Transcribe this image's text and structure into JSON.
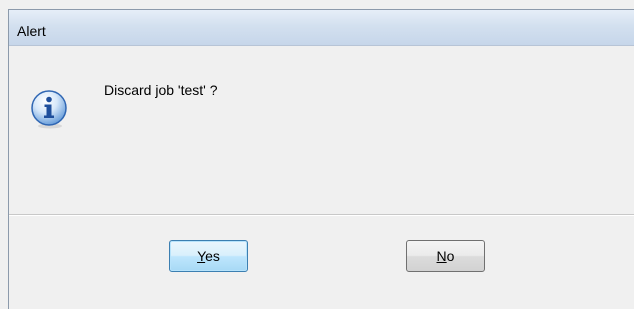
{
  "window": {
    "title": "Alert"
  },
  "message": {
    "text": "Discard job 'test' ?",
    "icon": "info-icon"
  },
  "buttons": {
    "yes": {
      "accel": "Y",
      "rest": "es"
    },
    "no": {
      "accel": "N",
      "rest": "o"
    }
  },
  "colors": {
    "dialog_bg": "#f0f0f0",
    "title_bar": "#d3e0ef",
    "icon_blue": "#2b6fc4"
  }
}
